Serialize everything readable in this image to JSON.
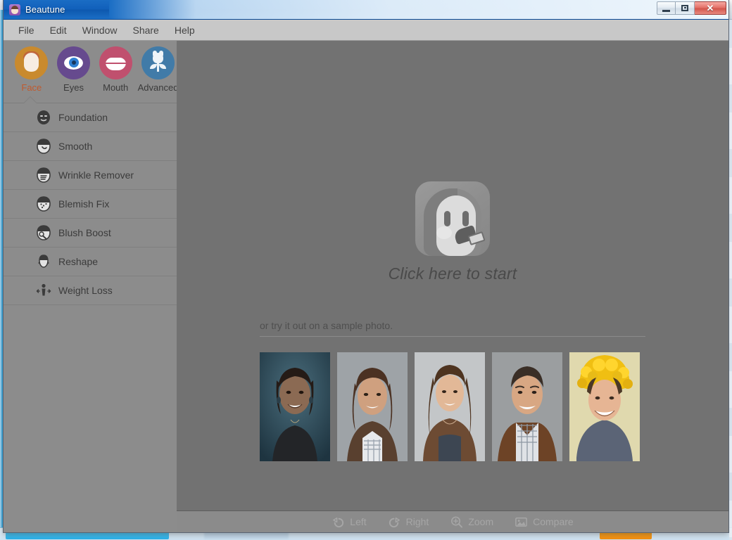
{
  "window": {
    "title": "Beautune",
    "app_icon": "beautune-app-icon",
    "controls": {
      "minimize": "minimize-button",
      "maximize": "maximize-button",
      "close_label": "✕"
    }
  },
  "menu": {
    "items": [
      {
        "label": "File",
        "name": "menu-file"
      },
      {
        "label": "Edit",
        "name": "menu-edit"
      },
      {
        "label": "Window",
        "name": "menu-window"
      },
      {
        "label": "Share",
        "name": "menu-share"
      },
      {
        "label": "Help",
        "name": "menu-help"
      }
    ]
  },
  "sidebar": {
    "tabs": [
      {
        "label": "Face",
        "icon": "face-icon",
        "active": true,
        "color": "#c98a2e"
      },
      {
        "label": "Eyes",
        "icon": "eye-icon",
        "active": false,
        "color": "#664a8e"
      },
      {
        "label": "Mouth",
        "icon": "lips-icon",
        "active": false,
        "color": "#c0506e"
      },
      {
        "label": "Advanced",
        "icon": "flower-icon",
        "active": false,
        "color": "#417ba8"
      }
    ],
    "active_tab_label_color": "#c05a2e",
    "tools": [
      {
        "label": "Foundation",
        "icon": "foundation-mask-icon"
      },
      {
        "label": "Smooth",
        "icon": "smooth-face-icon"
      },
      {
        "label": "Wrinkle Remover",
        "icon": "wrinkle-face-icon"
      },
      {
        "label": "Blemish Fix",
        "icon": "blemish-face-icon"
      },
      {
        "label": "Blush Boost",
        "icon": "blush-brush-icon"
      },
      {
        "label": "Reshape",
        "icon": "reshape-face-icon"
      },
      {
        "label": "Weight Loss",
        "icon": "weight-loss-icon"
      }
    ]
  },
  "main": {
    "start_prompt": "Click here to start",
    "start_icon": "face-with-makeup-brush-icon",
    "sample_caption": "or try it out on a sample photo.",
    "samples": [
      {
        "name": "sample-photo-1",
        "alt": "smiling woman with dark hair, teal background"
      },
      {
        "name": "sample-photo-2",
        "alt": "smiling woman with brown hair, grey background"
      },
      {
        "name": "sample-photo-3",
        "alt": "smiling young woman with long hair, light grey background"
      },
      {
        "name": "sample-photo-4",
        "alt": "smiling man in plaid shirt, grey background"
      },
      {
        "name": "sample-photo-5",
        "alt": "smiling woman in yellow knit hat, cream background"
      }
    ]
  },
  "bottom_bar": {
    "items": [
      {
        "label": "Left",
        "icon": "rotate-left-icon"
      },
      {
        "label": "Right",
        "icon": "rotate-right-icon"
      },
      {
        "label": "Zoom",
        "icon": "zoom-in-icon"
      },
      {
        "label": "Compare",
        "icon": "compare-image-icon"
      }
    ],
    "disabled_color": "#a6a6a6"
  },
  "theme": {
    "sidebar_bg": "#8c8c8c",
    "main_bg": "#727272",
    "menu_bg": "#c8c8c8",
    "titlebar_blue": "#1160bb",
    "close_red": "#d2564c"
  }
}
